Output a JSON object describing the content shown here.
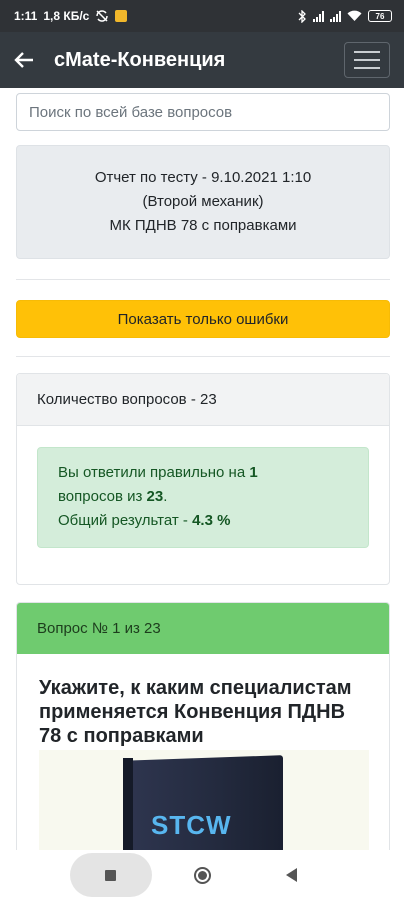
{
  "status_bar": {
    "time": "1:11",
    "speed": "1,8 КБ/с",
    "battery": "76"
  },
  "app_bar": {
    "title": "cMate-Конвенция",
    "back_icon": "arrow-left-icon",
    "menu_icon": "hamburger-menu-icon"
  },
  "search": {
    "placeholder": "Поиск по всей базе вопросов",
    "value": ""
  },
  "report": {
    "line1": "Отчет по тесту - 9.10.2021 1:10",
    "line2": "(Второй механик)",
    "line3": "МК ПДНВ 78 с поправками"
  },
  "errors_button": {
    "label": "Показать только ошибки",
    "color": "#ffc107"
  },
  "summary": {
    "header": "Количество вопросов - 23",
    "text1": "Вы ответили правильно на ",
    "correct": "1",
    "text2": "вопросов из ",
    "total": "23",
    "text2_end": ".",
    "text3": "Общий результат - ",
    "percent": "4.3 %",
    "color": "#d4edda"
  },
  "question": {
    "header": "Вопрос № 1 из 23",
    "header_color": "#6fcb6f",
    "text": "Укажите, к каким специалистам применяется Конвенция ПДНВ 78 с поправками",
    "image_text": "STCW"
  },
  "nav_bar": {
    "recent_icon": "square-recent-icon",
    "home_icon": "circle-home-icon",
    "back_icon": "triangle-back-icon"
  }
}
